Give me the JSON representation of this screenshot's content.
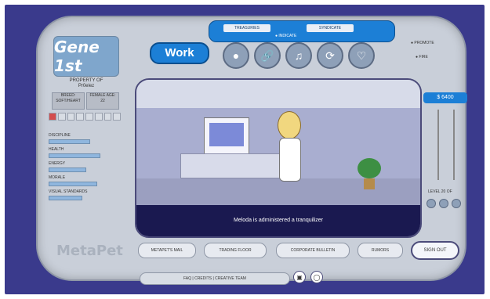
{
  "logo": {
    "text": "Gene 1st"
  },
  "owner": {
    "line1": "PROPERTY OF",
    "line2": "Pr0elez"
  },
  "tags": [
    "BREED: SOFT/HEART",
    "FEMALE AGE: 22"
  ],
  "stats": [
    {
      "label": "DISCIPLINE",
      "level": 0.55
    },
    {
      "label": "HEALTH",
      "level": 0.7
    },
    {
      "label": "ENERGY",
      "level": 0.5
    },
    {
      "label": "MORALE",
      "level": 0.65
    },
    {
      "label": "VISUAL STANDARDS",
      "level": 0.45
    }
  ],
  "work": {
    "label": "Work"
  },
  "topmenu": {
    "items": [
      "TREASURIES",
      "SYNDICATE"
    ],
    "indicate": "● INDICATE"
  },
  "icons": [
    "pill-icon",
    "link-icon",
    "sound-icon",
    "cycle-icon",
    "bone-icon"
  ],
  "right": {
    "promote": "PROMOTE",
    "fire": "FIRE",
    "money": "$ 6400",
    "level": "LEVEL 20 OF"
  },
  "scene": {
    "caption": "Meloda is administered a tranquilizer"
  },
  "wordmark": {
    "text": "MetaPet"
  },
  "nav": [
    "METAPET'S MAIL",
    "TRADING FLOOR",
    "CORPORATE BULLETIN",
    "RUMORS"
  ],
  "signout": {
    "label": "SIGN OUT"
  },
  "footer": {
    "text": "FAQ  |  CREDITS  |  CREATIVE TEAM"
  },
  "colors": {
    "frame": "#3a3a8c",
    "accent": "#1c7fd6",
    "scene": "#1a1950"
  }
}
